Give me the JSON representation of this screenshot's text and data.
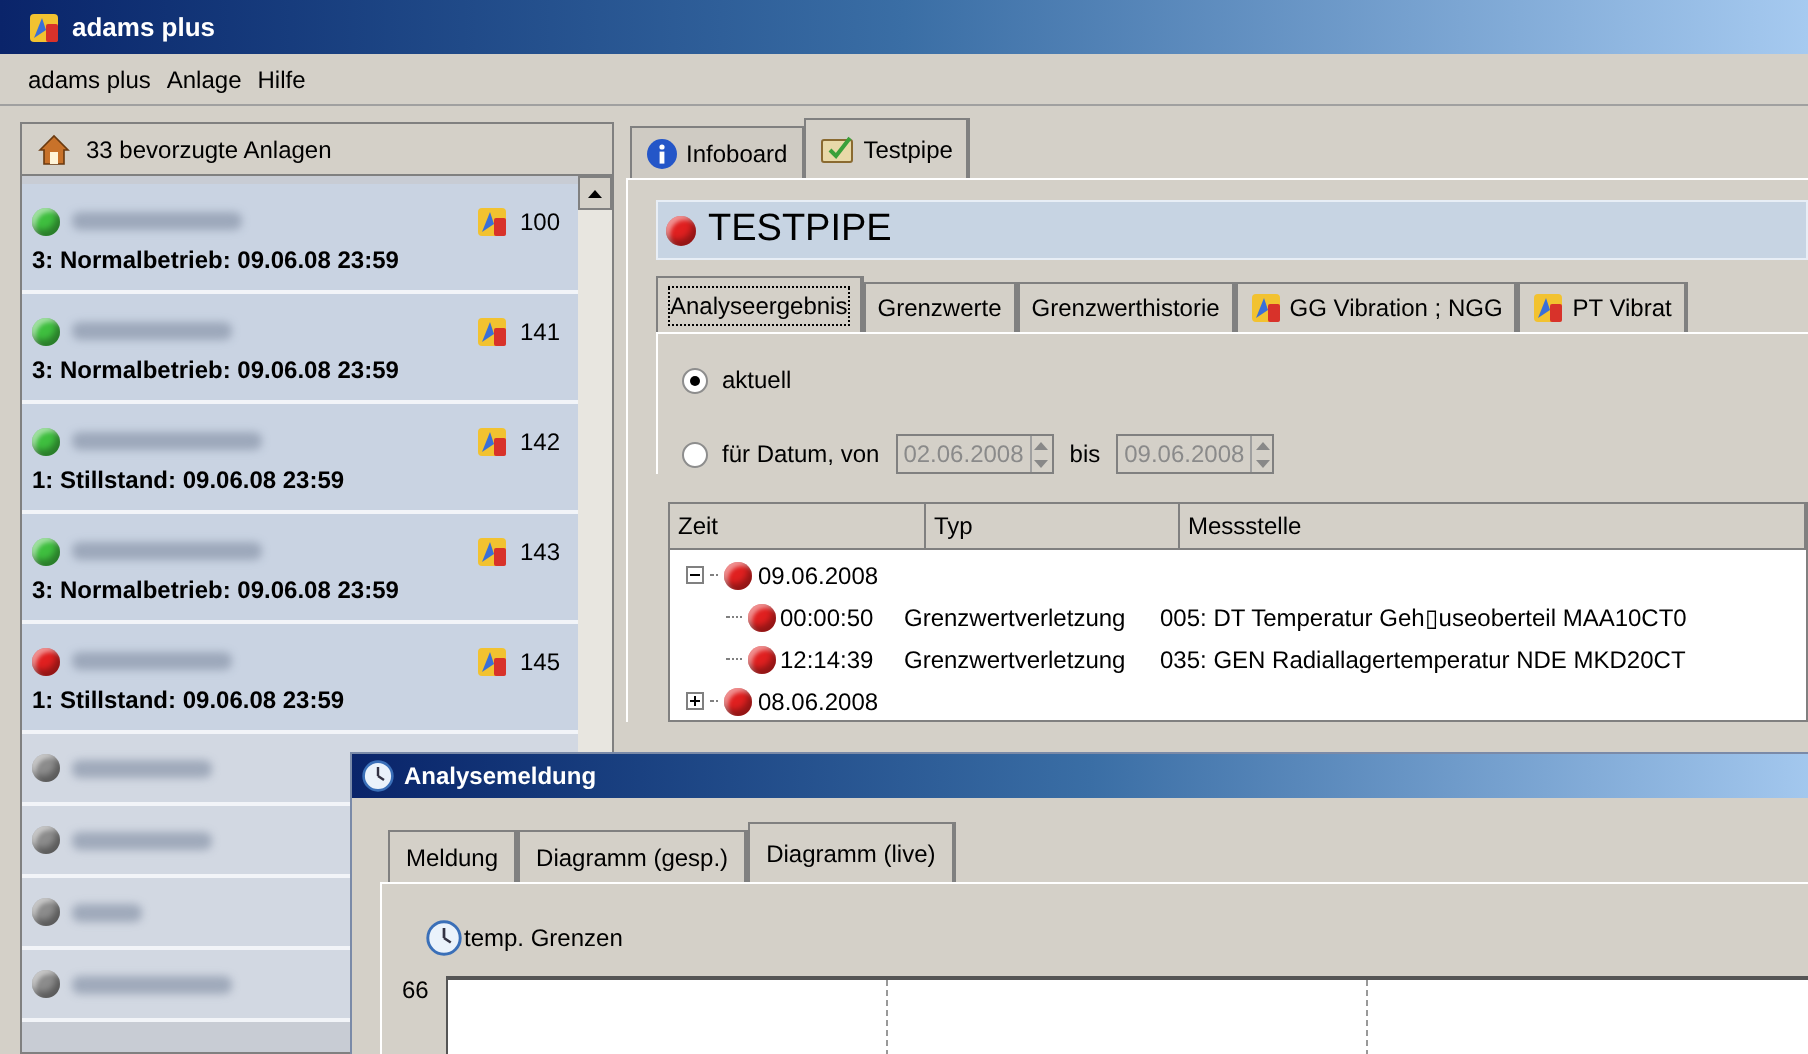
{
  "window": {
    "title": "adams plus"
  },
  "menu": [
    "adams plus",
    "Anlage",
    "Hilfe"
  ],
  "sidebar": {
    "header": "33 bevorzugte Anlagen",
    "items": [
      {
        "kind": "status",
        "color": "#3fbf3f",
        "count": "100",
        "status_text": "3: Normalbetrieb: 09.06.08 23:59"
      },
      {
        "kind": "status",
        "color": "#3fbf3f",
        "count": "141",
        "status_text": "3: Normalbetrieb: 09.06.08 23:59"
      },
      {
        "kind": "status",
        "color": "#3fbf3f",
        "count": "142",
        "status_text": "1: Stillstand: 09.06.08 23:59"
      },
      {
        "kind": "status",
        "color": "#3fbf3f",
        "count": "143",
        "status_text": "3: Normalbetrieb: 09.06.08 23:59"
      },
      {
        "kind": "status",
        "color": "#e02020",
        "count": "145",
        "status_text": "1: Stillstand: 09.06.08 23:59"
      },
      {
        "kind": "plain",
        "color": "#8c8c8c"
      },
      {
        "kind": "plain",
        "color": "#8c8c8c"
      },
      {
        "kind": "plain",
        "color": "#8c8c8c"
      },
      {
        "kind": "plain",
        "color": "#8c8c8c"
      }
    ]
  },
  "tabs": [
    {
      "label": "Infoboard",
      "kind": "info",
      "selected": false
    },
    {
      "label": "Testpipe",
      "kind": "board",
      "selected": true
    }
  ],
  "plant": {
    "title": "TESTPIPE",
    "color": "#e02020"
  },
  "subtabs": [
    {
      "label": "Analyseergebnis",
      "kind": "text",
      "selected": true
    },
    {
      "label": "Grenzwerte",
      "kind": "text",
      "selected": false
    },
    {
      "label": "Grenzwerthistorie",
      "kind": "text",
      "selected": false
    },
    {
      "label": "GG Vibration ; NGG",
      "kind": "app",
      "selected": false
    },
    {
      "label": "PT Vibrat",
      "kind": "app",
      "selected": false
    }
  ],
  "range": {
    "current": {
      "label": "aktuell",
      "selected": true
    },
    "by_date": {
      "label": "für Datum, von",
      "selected": false
    },
    "from": "02.06.2008",
    "to_label": "bis",
    "to": "09.06.2008",
    "disabled": true
  },
  "table": {
    "columns": [
      "Zeit",
      "Typ",
      "Messstelle"
    ],
    "groups": [
      {
        "date": "09.06.2008",
        "expanded": true,
        "children": [
          {
            "time": "00:00:50",
            "type": "Grenzwertverletzung",
            "point": "005:  DT Temperatur Geh▯useoberteil MAA10CT0"
          },
          {
            "time": "12:14:39",
            "type": "Grenzwertverletzung",
            "point": "035:  GEN Radiallagertemperatur NDE MKD20CT"
          }
        ]
      },
      {
        "date": "08.06.2008",
        "expanded": false
      }
    ]
  },
  "dialog": {
    "title": "Analysemeldung",
    "tabs": [
      {
        "label": "Meldung",
        "selected": false
      },
      {
        "label": "Diagramm (gesp.)",
        "selected": false
      },
      {
        "label": "Diagramm (live)",
        "selected": true
      }
    ],
    "toggle": "temp. Grenzen",
    "y_tick": "66"
  }
}
